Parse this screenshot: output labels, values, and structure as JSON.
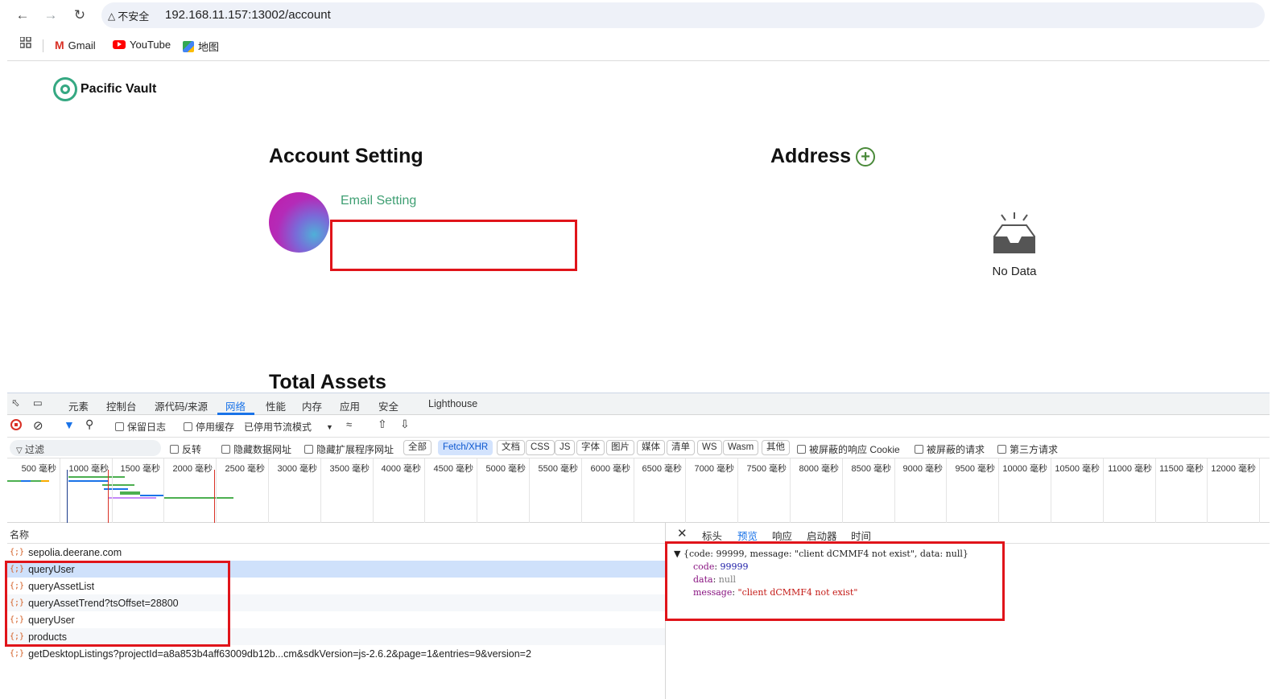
{
  "browser": {
    "insecure_label": "不安全",
    "url": "192.168.11.157:13002/account",
    "bookmarks": [
      {
        "label": "Gmail",
        "icon": "gmail-icon"
      },
      {
        "label": "YouTube",
        "icon": "youtube-icon"
      },
      {
        "label": "地图",
        "icon": "maps-icon"
      }
    ]
  },
  "page": {
    "brand": "Pacific Vault",
    "account_title": "Account Setting",
    "email_label": "Email Setting",
    "address_title": "Address",
    "no_data": "No Data",
    "total_assets_title": "Total Assets",
    "accent_color": "#3f9f73"
  },
  "devtools": {
    "tabs": [
      "元素",
      "控制台",
      "源代码/来源",
      "网络",
      "性能",
      "内存",
      "应用",
      "安全",
      "Lighthouse"
    ],
    "active_tab": "网络",
    "toolbar": {
      "preserve_log": "保留日志",
      "disable_cache": "停用缓存",
      "throttle": "已停用节流模式"
    },
    "filter": {
      "placeholder": "过滤",
      "invert": "反转",
      "hide_data_urls": "隐藏数据网址",
      "hide_ext_urls": "隐藏扩展程序网址",
      "types": [
        "全部",
        "Fetch/XHR",
        "文档",
        "CSS",
        "JS",
        "字体",
        "图片",
        "媒体",
        "清单",
        "WS",
        "Wasm",
        "其他"
      ],
      "active_type": "Fetch/XHR",
      "blocked_cookies": "被屏蔽的响应 Cookie",
      "blocked_requests": "被屏蔽的请求",
      "third_party": "第三方请求"
    },
    "timeline_ticks": [
      "500 毫秒",
      "1000 毫秒",
      "1500 毫秒",
      "2000 毫秒",
      "2500 毫秒",
      "3000 毫秒",
      "3500 毫秒",
      "4000 毫秒",
      "4500 毫秒",
      "5000 毫秒",
      "5500 毫秒",
      "6000 毫秒",
      "6500 毫秒",
      "7000 毫秒",
      "7500 毫秒",
      "8000 毫秒",
      "8500 毫秒",
      "9000 毫秒",
      "9500 毫秒",
      "10000 毫秒",
      "10500 毫秒",
      "11000 毫秒",
      "11500 毫秒",
      "12000 毫秒"
    ],
    "list_header": "名称",
    "requests": [
      "sepolia.deerane.com",
      "queryUser",
      "queryAssetList",
      "queryAssetTrend?tsOffset=28800",
      "queryUser",
      "products",
      "getDesktopListings?projectId=a8a853b4aff63009db12b...cm&sdkVersion=js-2.6.2&page=1&entries=9&version=2"
    ],
    "selected_request": 1,
    "detail_tabs": [
      "标头",
      "预览",
      "响应",
      "启动器",
      "时间"
    ],
    "active_detail_tab": "预览",
    "preview": {
      "summary": "{code: 99999, message: \"client dCMMF4 not exist\", data: null}",
      "code_key": "code",
      "code_val": "99999",
      "data_key": "data",
      "data_val": "null",
      "message_key": "message",
      "message_val": "\"client dCMMF4 not exist\""
    }
  }
}
